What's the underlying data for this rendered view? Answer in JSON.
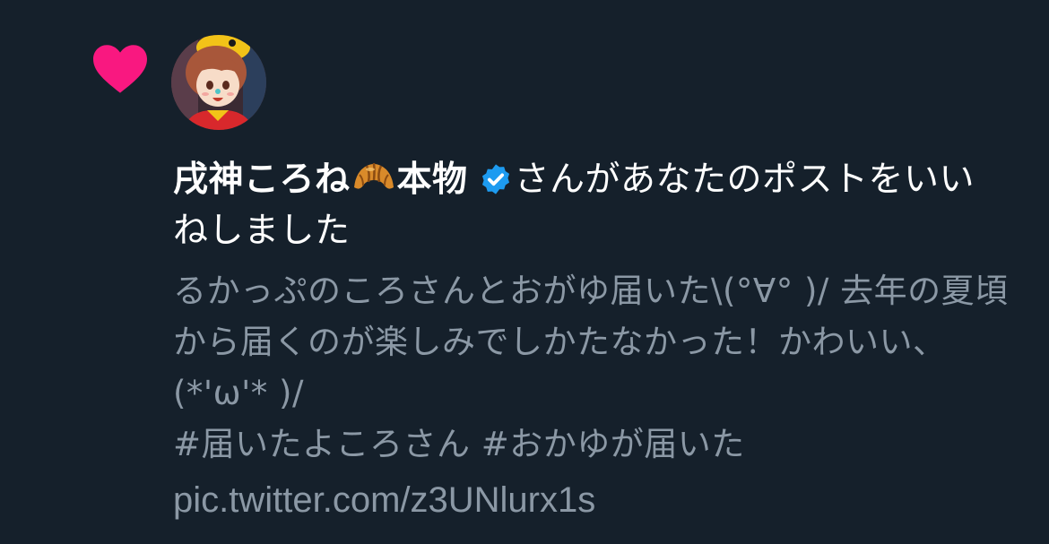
{
  "notification": {
    "type_icon": "heart-icon",
    "icon_color": "#f91880",
    "actor": {
      "name": "戌神ころね",
      "name_emoji": "croissant-emoji",
      "name_suffix": "本物",
      "verified_icon": "verified-badge-icon",
      "verified_color": "#1d9bf0"
    },
    "action_text": "さんがあなたのポストをいいねしました",
    "tweet": {
      "text": "るかっぷのころさんとおがゆ届いた\\(°∀° )/ 去年の夏頃から届くのが楽しみでしかたなかった！かわいい、(*'ω'* )/\n #届いたよころさん  #おかゆが届いた",
      "link": "pic.twitter.com/z3UNlurx1s"
    }
  },
  "colors": {
    "background": "#15202b",
    "primary_text": "#ffffff",
    "secondary_text": "#8b98a5"
  }
}
